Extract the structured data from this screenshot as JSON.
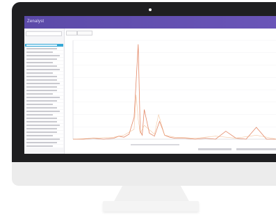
{
  "app": {
    "brand": "Zenalyst"
  },
  "sidebar": {
    "item_count": 30,
    "selected_index": 0
  },
  "chart_data": {
    "type": "line",
    "series": [
      {
        "color": "#e07b57",
        "x": [
          0,
          10,
          20,
          30,
          40,
          45,
          50,
          55,
          60,
          64,
          66,
          68,
          70,
          75,
          80,
          85,
          88,
          90,
          95,
          100,
          110,
          120,
          130,
          140,
          150,
          160,
          170,
          180,
          190,
          200
        ],
        "values": [
          0,
          0,
          1,
          0,
          1,
          3,
          2,
          5,
          22,
          96,
          8,
          4,
          30,
          6,
          3,
          18,
          10,
          4,
          2,
          1,
          1,
          0,
          1,
          0,
          8,
          1,
          0,
          12,
          0,
          0
        ]
      },
      {
        "color": "#f0b07e",
        "x": [
          0,
          20,
          40,
          50,
          60,
          62,
          64,
          66,
          70,
          80,
          84,
          90,
          100,
          120,
          140,
          160,
          180,
          200
        ],
        "values": [
          0,
          1,
          2,
          4,
          10,
          45,
          20,
          6,
          14,
          5,
          25,
          4,
          2,
          1,
          3,
          1,
          4,
          0
        ]
      }
    ],
    "ylim": [
      0,
      100
    ],
    "grid": true,
    "legend": "none"
  }
}
